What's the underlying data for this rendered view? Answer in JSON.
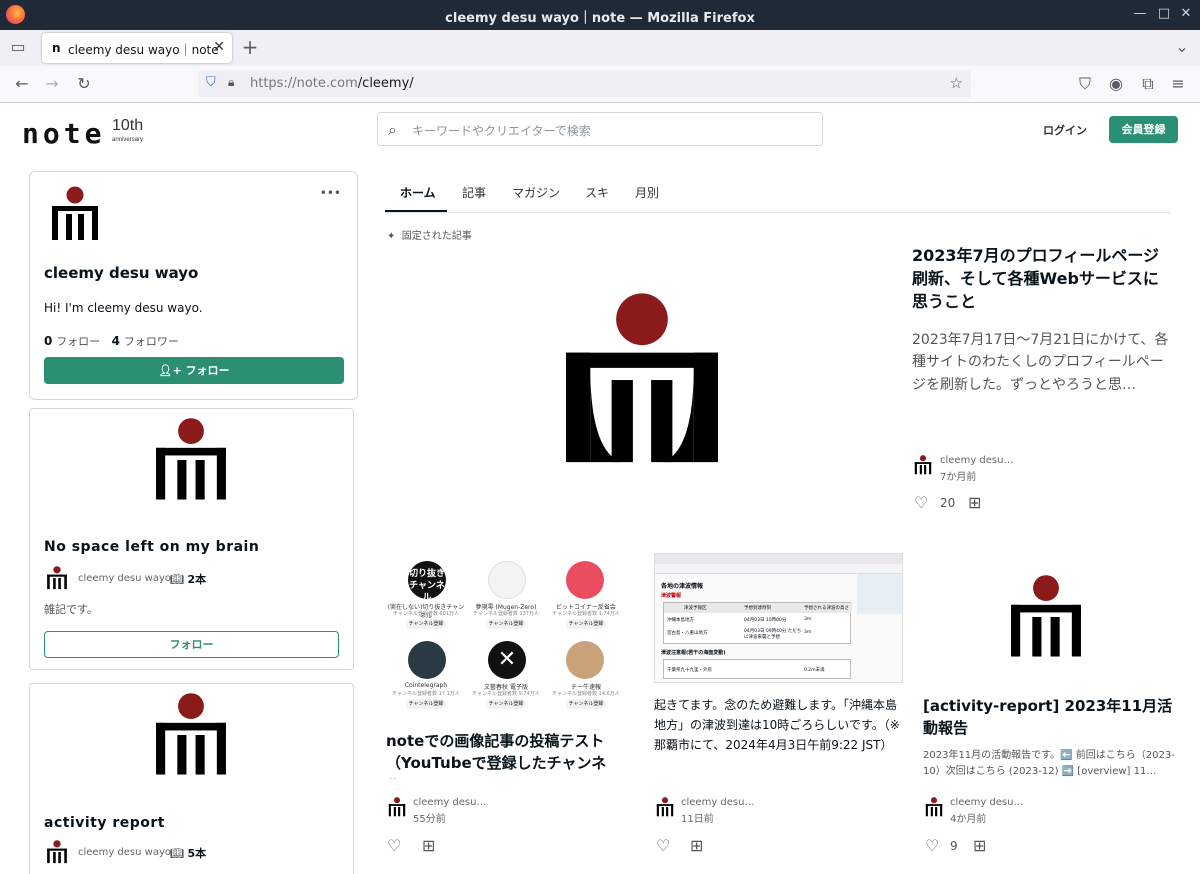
{
  "window": {
    "title": "cleemy desu wayo｜note — Mozilla Firefox"
  },
  "tabbar": {
    "tab_label": "cleemy desu wayo｜note",
    "tab_favicon": "n"
  },
  "navbar": {
    "url_host": "https://note.com",
    "url_path": "/cleemy/"
  },
  "header": {
    "logo": "note",
    "logo_badge": "10th",
    "logo_badge_sub": "anniversary",
    "search_placeholder": "キーワードやクリエイターで検索",
    "login": "ログイン",
    "signup": "会員登録"
  },
  "profile": {
    "name": "cleemy desu wayo",
    "bio": "Hi! I'm cleemy desu wayo.",
    "following_count": "0",
    "following_label": "フォロー",
    "followers_count": "4",
    "followers_label": "フォロワー",
    "follow_button": "フォロー",
    "menu": "•••"
  },
  "magazines": [
    {
      "title": "No space left on my brain",
      "author": "cleemy desu wayo",
      "count": "2本",
      "desc": "雑記です。",
      "follow": "フォロー"
    },
    {
      "title": "activity report",
      "author": "cleemy desu wayo",
      "count": "5本"
    }
  ],
  "main_tabs": [
    "ホーム",
    "記事",
    "マガジン",
    "スキ",
    "月別"
  ],
  "pinned_label": "固定された記事",
  "pinned": {
    "title": "2023年7月のプロフィールページ刷新、そして各種Webサービスに思うこと",
    "excerpt": "2023年7月17日〜7月21日にかけて、各種サイトのわたくしのプロフィールページを刷新した。ずっとやろうと思…",
    "author": "cleemy desu…",
    "when": "7か月前",
    "likes": "20"
  },
  "articles": [
    {
      "title": "noteでの画像記事の投稿テスト（YouTubeで登録したチャンネル…",
      "author": "cleemy desu…",
      "when": "55分前",
      "likes": "",
      "thumb_channels": [
        {
          "name": "(実在しない)切り抜きチャンネル",
          "sub": "チャンネル登録者数 601万人",
          "btn": "チャンネル登録"
        },
        {
          "name": "夢現零 (Mugen-Zero)",
          "sub": "チャンネル登録者数 137万人",
          "btn": "チャンネル登録"
        },
        {
          "name": "ビットコイナー反省会",
          "sub": "チャンネル登録者数 1.74万人",
          "btn": "チャンネル登録"
        },
        {
          "name": "Cointelegraph",
          "sub": "チャンネル登録者数 17.1万人",
          "btn": "チャンネル登録"
        },
        {
          "name": "文藝春秋 電子版",
          "sub": "チャンネル登録者数 9.74万人",
          "btn": "チャンネル登録"
        },
        {
          "name": "チー牛速報",
          "sub": "チャンネル登録者数 14.6万人",
          "btn": "チャンネル登録"
        }
      ]
    },
    {
      "title": "起きてます。念のため避難します。「沖縄本島地方」の津波到達は10時ごろらしいです。（※那覇市にて、2024年4月3日午前9:22 JST）",
      "author": "cleemy desu…",
      "when": "11日前",
      "likes": ""
    },
    {
      "title": "[activity-report] 2023年11月活動報告",
      "excerpt": "2023年11月の活動報告です。⬅️ 前回はこちら（2023-10）次回はこちら (2023-12) ➡️ [overview] 11…",
      "author": "cleemy desu…",
      "when": "4か月前",
      "likes": "9"
    }
  ],
  "thumb_tsunami": {
    "heading": "各地の津波情報",
    "sub": "津波警報",
    "col1": "津波予報区",
    "col2": "予想到達時刻",
    "col3": "予想される津波の高さ",
    "r1": [
      "沖縄本島地方",
      "04月03日 10時00分",
      "3m"
    ],
    "r2": [
      "宮古島・八重山地方",
      "04月03日 09時40分 ただちに津波来襲と予想",
      "3m"
    ],
    "sub2": "津波注意報(若干の海面変動)",
    "r3": [
      "千葉県九十九里・外房",
      "",
      "0.2m未満"
    ]
  },
  "colors": {
    "brand": "#2a8f73",
    "logo_red": "#8b1a1a"
  }
}
